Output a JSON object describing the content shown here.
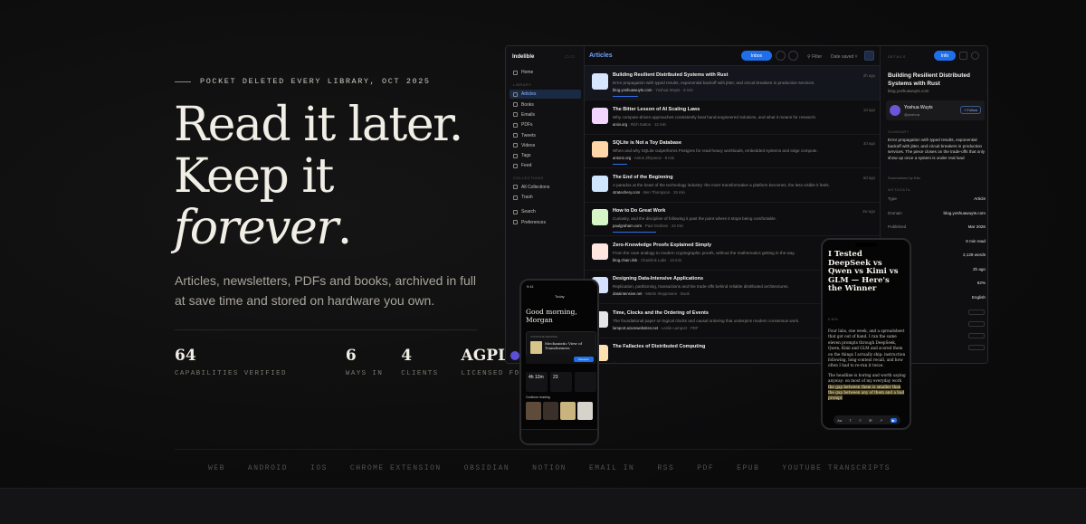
{
  "hero": {
    "eyebrow": "POCKET DELETED EVERY LIBRARY, OCT 2025",
    "line1": "Read it later.",
    "line2": "Keep it",
    "line3": "forever",
    "line3_suffix": ".",
    "subtitle": "Articles, newsletters, PDFs and books, archived in full at save time and stored on hardware you own.",
    "stats": [
      {
        "value": "64",
        "label": "CAPABILITIES VERIFIED"
      },
      {
        "value": "6",
        "label": "WAYS IN"
      },
      {
        "value": "4",
        "label": "CLIENTS"
      },
      {
        "value": "AGPL",
        "label": "LICENSED FOREVER"
      }
    ],
    "channels": [
      "WEB",
      "ANDROID",
      "IOS",
      "CHROME EXTENSION",
      "OBSIDIAN",
      "NOTION",
      "EMAIL IN",
      "RSS",
      "PDF",
      "EPUB",
      "YOUTUBE TRANSCRIPTS"
    ]
  },
  "app": {
    "brand": "Indelible",
    "nav_home": "Home",
    "group_library": "LIBRARY",
    "library": [
      "Articles",
      "Books",
      "Emails",
      "PDFs",
      "Tweets",
      "Videos",
      "Tags",
      "Feed"
    ],
    "group_collections": "COLLECTIONS",
    "collections": [
      "All Collections",
      "Trash"
    ],
    "bottom": [
      "Search",
      "Preferences"
    ],
    "list_title": "Articles",
    "inbox": "Inbox",
    "filter": "Filter",
    "sort": "Date saved",
    "articles": [
      {
        "title": "Building Resilient Distributed Systems with Rust",
        "desc": "Error propagation with typed results, exponential backoff with jitter, and circuit breakers in production services.",
        "domain": "blog.yoshuawuyts.com",
        "author": "Yoshua Wuyts",
        "read": "8 min",
        "age": "2h ago",
        "color": "#d6e6ff",
        "progress": 0.35
      },
      {
        "title": "The Bitter Lesson of AI Scaling Laws",
        "desc": "Why compute-driven approaches consistently beat hand-engineered solutions, and what it means for research.",
        "domain": "arxiv.org",
        "author": "Rich Sutton",
        "read": "12 min",
        "age": "1d ago",
        "color": "#f3d6ff",
        "progress": 0
      },
      {
        "title": "SQLite is Not a Toy Database",
        "desc": "When and why SQLite outperforms Postgres for read-heavy workloads, embedded systems and edge compute.",
        "domain": "antonz.org",
        "author": "Anton Zhiyanov",
        "read": "9 min",
        "age": "3d ago",
        "color": "#ffd6a8",
        "progress": 0.2
      },
      {
        "title": "The End of the Beginning",
        "desc": "A paradox at the heart of the technology industry: the more transformative a platform becomes, the less visible it feels.",
        "domain": "stratechery.com",
        "author": "Ben Thompson",
        "read": "15 min",
        "age": "6d ago",
        "color": "#cfe6ff",
        "progress": 0
      },
      {
        "title": "How to Do Great Work",
        "desc": "Curiosity, and the discipline of following it past the point where it stops being comfortable.",
        "domain": "paulgraham.com",
        "author": "Paul Graham",
        "read": "24 min",
        "age": "2w ago",
        "color": "#d8f5c8",
        "progress": 0.6
      },
      {
        "title": "Zero-Knowledge Proofs Explained Simply",
        "desc": "From the cave analogy to modern cryptographic proofs, without the mathematics getting in the way.",
        "domain": "blog.chain.link",
        "author": "Chainlink Labs",
        "read": "13 min",
        "age": "",
        "color": "#ffe6e0",
        "progress": 0
      },
      {
        "title": "Designing Data-Intensive Applications",
        "desc": "Replication, partitioning, transactions and the trade-offs behind reliable distributed architectures.",
        "domain": "dataintensive.net",
        "author": "Martin Kleppmann",
        "read": "Book",
        "age": "",
        "color": "#d6e0ff",
        "progress": 0
      },
      {
        "title": "Time, Clocks and the Ordering of Events",
        "desc": "The foundational paper on logical clocks and causal ordering that underpins modern consensus work.",
        "domain": "lamport.azurewebsites.net",
        "author": "Leslie Lamport",
        "read": "PDF",
        "age": "",
        "color": "#e6e6e6",
        "progress": 0
      },
      {
        "title": "The Fallacies of Distributed Computing",
        "desc": "",
        "domain": "",
        "author": "",
        "read": "",
        "age": "",
        "color": "#ffe0b0",
        "progress": 0
      }
    ],
    "details": {
      "label": "DETAILS",
      "info": "Info",
      "title": "Building Resilient Distributed Systems with Rust",
      "domain": "blog.yoshuawuyts.com",
      "author_name": "Yoshua Wuyts",
      "author_handle": "@yoshua",
      "follow": "+ Follow",
      "summary_label": "SUMMARY",
      "summary": "Error propagation with typed results, exponential backoff with jitter, and circuit breakers in production services. The piece closes on the trade-offs that only show up once a system is under real load",
      "summary_by": "Summarised by Ella",
      "metadata_label": "METADATA",
      "meta": [
        {
          "k": "Type",
          "v": "Article"
        },
        {
          "k": "Domain",
          "v": "blog.yoshuawuyts.com"
        },
        {
          "k": "Published",
          "v": "Mar 2026"
        },
        {
          "k": "",
          "v": "8 min read"
        },
        {
          "k": "",
          "v": "2,129 words"
        },
        {
          "k": "",
          "v": "2h ago"
        },
        {
          "k": "",
          "v": "62%"
        },
        {
          "k": "",
          "v": "English"
        }
      ]
    }
  },
  "phone1": {
    "time": "9:41",
    "today": "Today",
    "greeting": "Good morning, Morgan",
    "card_label": "CONTINUE READING",
    "card_title": "Mechanistic View of Transformers",
    "go": "Resume",
    "stat1": "4h 12m",
    "stat2": "23",
    "continue": "Continue reading"
  },
  "phone2": {
    "title": "I Tested DeepSeek vs Qwen vs Kimi vs GLM — Here's the Winner",
    "readtime": "8 MIN",
    "p1": "Four labs, one week, and a spreadsheet that got out of hand. I ran the same eleven prompts through DeepSeek, Qwen, Kimi and GLM and scored them on the things I actually ship: instruction following, long-context recall, and how often I had to re-run it twice.",
    "p2a": "The headline is boring and worth saying anyway: on most of my everyday work ",
    "p2_highlight": "the gap between them is smaller than the gap between any of them and a bad prompt",
    "toolbar": [
      "Aa",
      "T",
      "≡",
      "✉",
      "↗",
      "▶"
    ]
  }
}
